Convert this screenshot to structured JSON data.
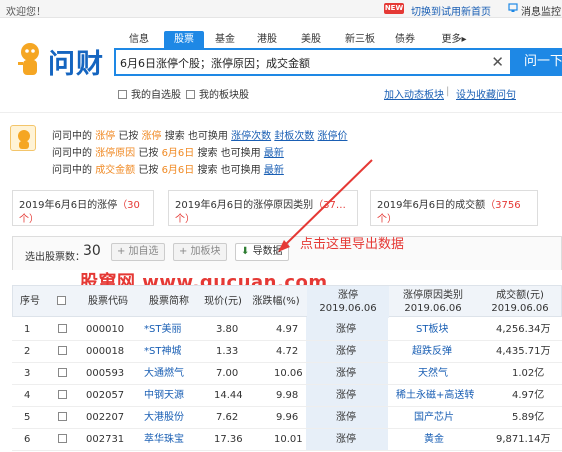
{
  "topbar": {
    "welcome": "欢迎您！",
    "new_badge": "NEW",
    "switch_link": "切换到试用新首页",
    "message_link": "消息监控"
  },
  "logo": {
    "text": "问财"
  },
  "nav": {
    "tabs": [
      "信息",
      "股票",
      "基金",
      "港股",
      "美股",
      "新三板",
      "债券",
      "更多▸"
    ],
    "active": "股票"
  },
  "search": {
    "value": "6月6日涨停个股；涨停原因；成交金额",
    "button": "问一下"
  },
  "options": {
    "my_stocks": "我的自选股",
    "my_sectors": "我的板块股",
    "add_dynamic": "加入动态板块",
    "set_favorite": "设为收藏问句"
  },
  "info": {
    "line1": {
      "prefix": "问司中的",
      "term": "涨停",
      "mid": "已按",
      "term2": "涨停",
      "suffix": "搜索  也可换用",
      "alt1": "涨停次数",
      "alt2": "封板次数",
      "alt3": "涨停价"
    },
    "line2": {
      "prefix": "问司中的",
      "term": "涨停原因",
      "mid": "已按",
      "term2": "6月6日",
      "suffix": "搜索  也可换用",
      "alt1": "最新"
    },
    "line3": {
      "prefix": "问司中的",
      "term": "成交金额",
      "mid": "已按",
      "term2": "6月6日",
      "suffix": "搜索  也可换用",
      "alt1": "最新"
    }
  },
  "result_tabs": [
    {
      "label": "2019年6月6日的涨停",
      "count": "（30个）"
    },
    {
      "label": "2019年6月6日的涨停原因类别",
      "count": "（37…个）"
    },
    {
      "label": "2019年6月6日的成交额",
      "count": "（3756个）"
    }
  ],
  "toolbar": {
    "selected_label": "选出股票数：",
    "selected_count": "30",
    "add_watch": "+ 加自选",
    "add_sector": "+ 加板块",
    "export": "导数据"
  },
  "annotation": "点击这里导出数据",
  "watermark": "股窜网 www.gucuan.com",
  "table": {
    "headers": {
      "seq": "序号",
      "code": "股票代码",
      "name": "股票简称",
      "price": "现价(元)",
      "change": "涨跌幅(%)",
      "zt": "涨停",
      "zt_date": "2019.06.06",
      "reason": "涨停原因类别",
      "reason_date": "2019.06.06",
      "amount": "成交额(元)",
      "amount_date": "2019.06.06"
    },
    "rows": [
      {
        "seq": "1",
        "code": "000010",
        "name": "*ST美丽",
        "price": "3.80",
        "change": "4.97",
        "zt": "涨停",
        "reason": "ST板块",
        "amount": "4,256.34万"
      },
      {
        "seq": "2",
        "code": "000018",
        "name": "*ST神城",
        "price": "1.33",
        "change": "4.72",
        "zt": "涨停",
        "reason": "超跌反弹",
        "amount": "4,435.71万"
      },
      {
        "seq": "3",
        "code": "000593",
        "name": "大通燃气",
        "price": "7.00",
        "change": "10.06",
        "zt": "涨停",
        "reason": "天然气",
        "amount": "1.02亿"
      },
      {
        "seq": "4",
        "code": "002057",
        "name": "中钢天源",
        "price": "14.44",
        "change": "9.98",
        "zt": "涨停",
        "reason": "稀土永磁+高送转",
        "amount": "4.97亿"
      },
      {
        "seq": "5",
        "code": "002207",
        "name": "大港股份",
        "price": "7.62",
        "change": "9.96",
        "zt": "涨停",
        "reason": "国产芯片",
        "amount": "5.89亿"
      },
      {
        "seq": "6",
        "code": "002731",
        "name": "萃华珠宝",
        "price": "17.36",
        "change": "10.01",
        "zt": "涨停",
        "reason": "黄金",
        "amount": "9,871.14万"
      }
    ]
  },
  "colors": {
    "accent": "#1e88e5",
    "up": "#e53935",
    "link": "#1a5fb4",
    "highlight": "#f08a24"
  }
}
